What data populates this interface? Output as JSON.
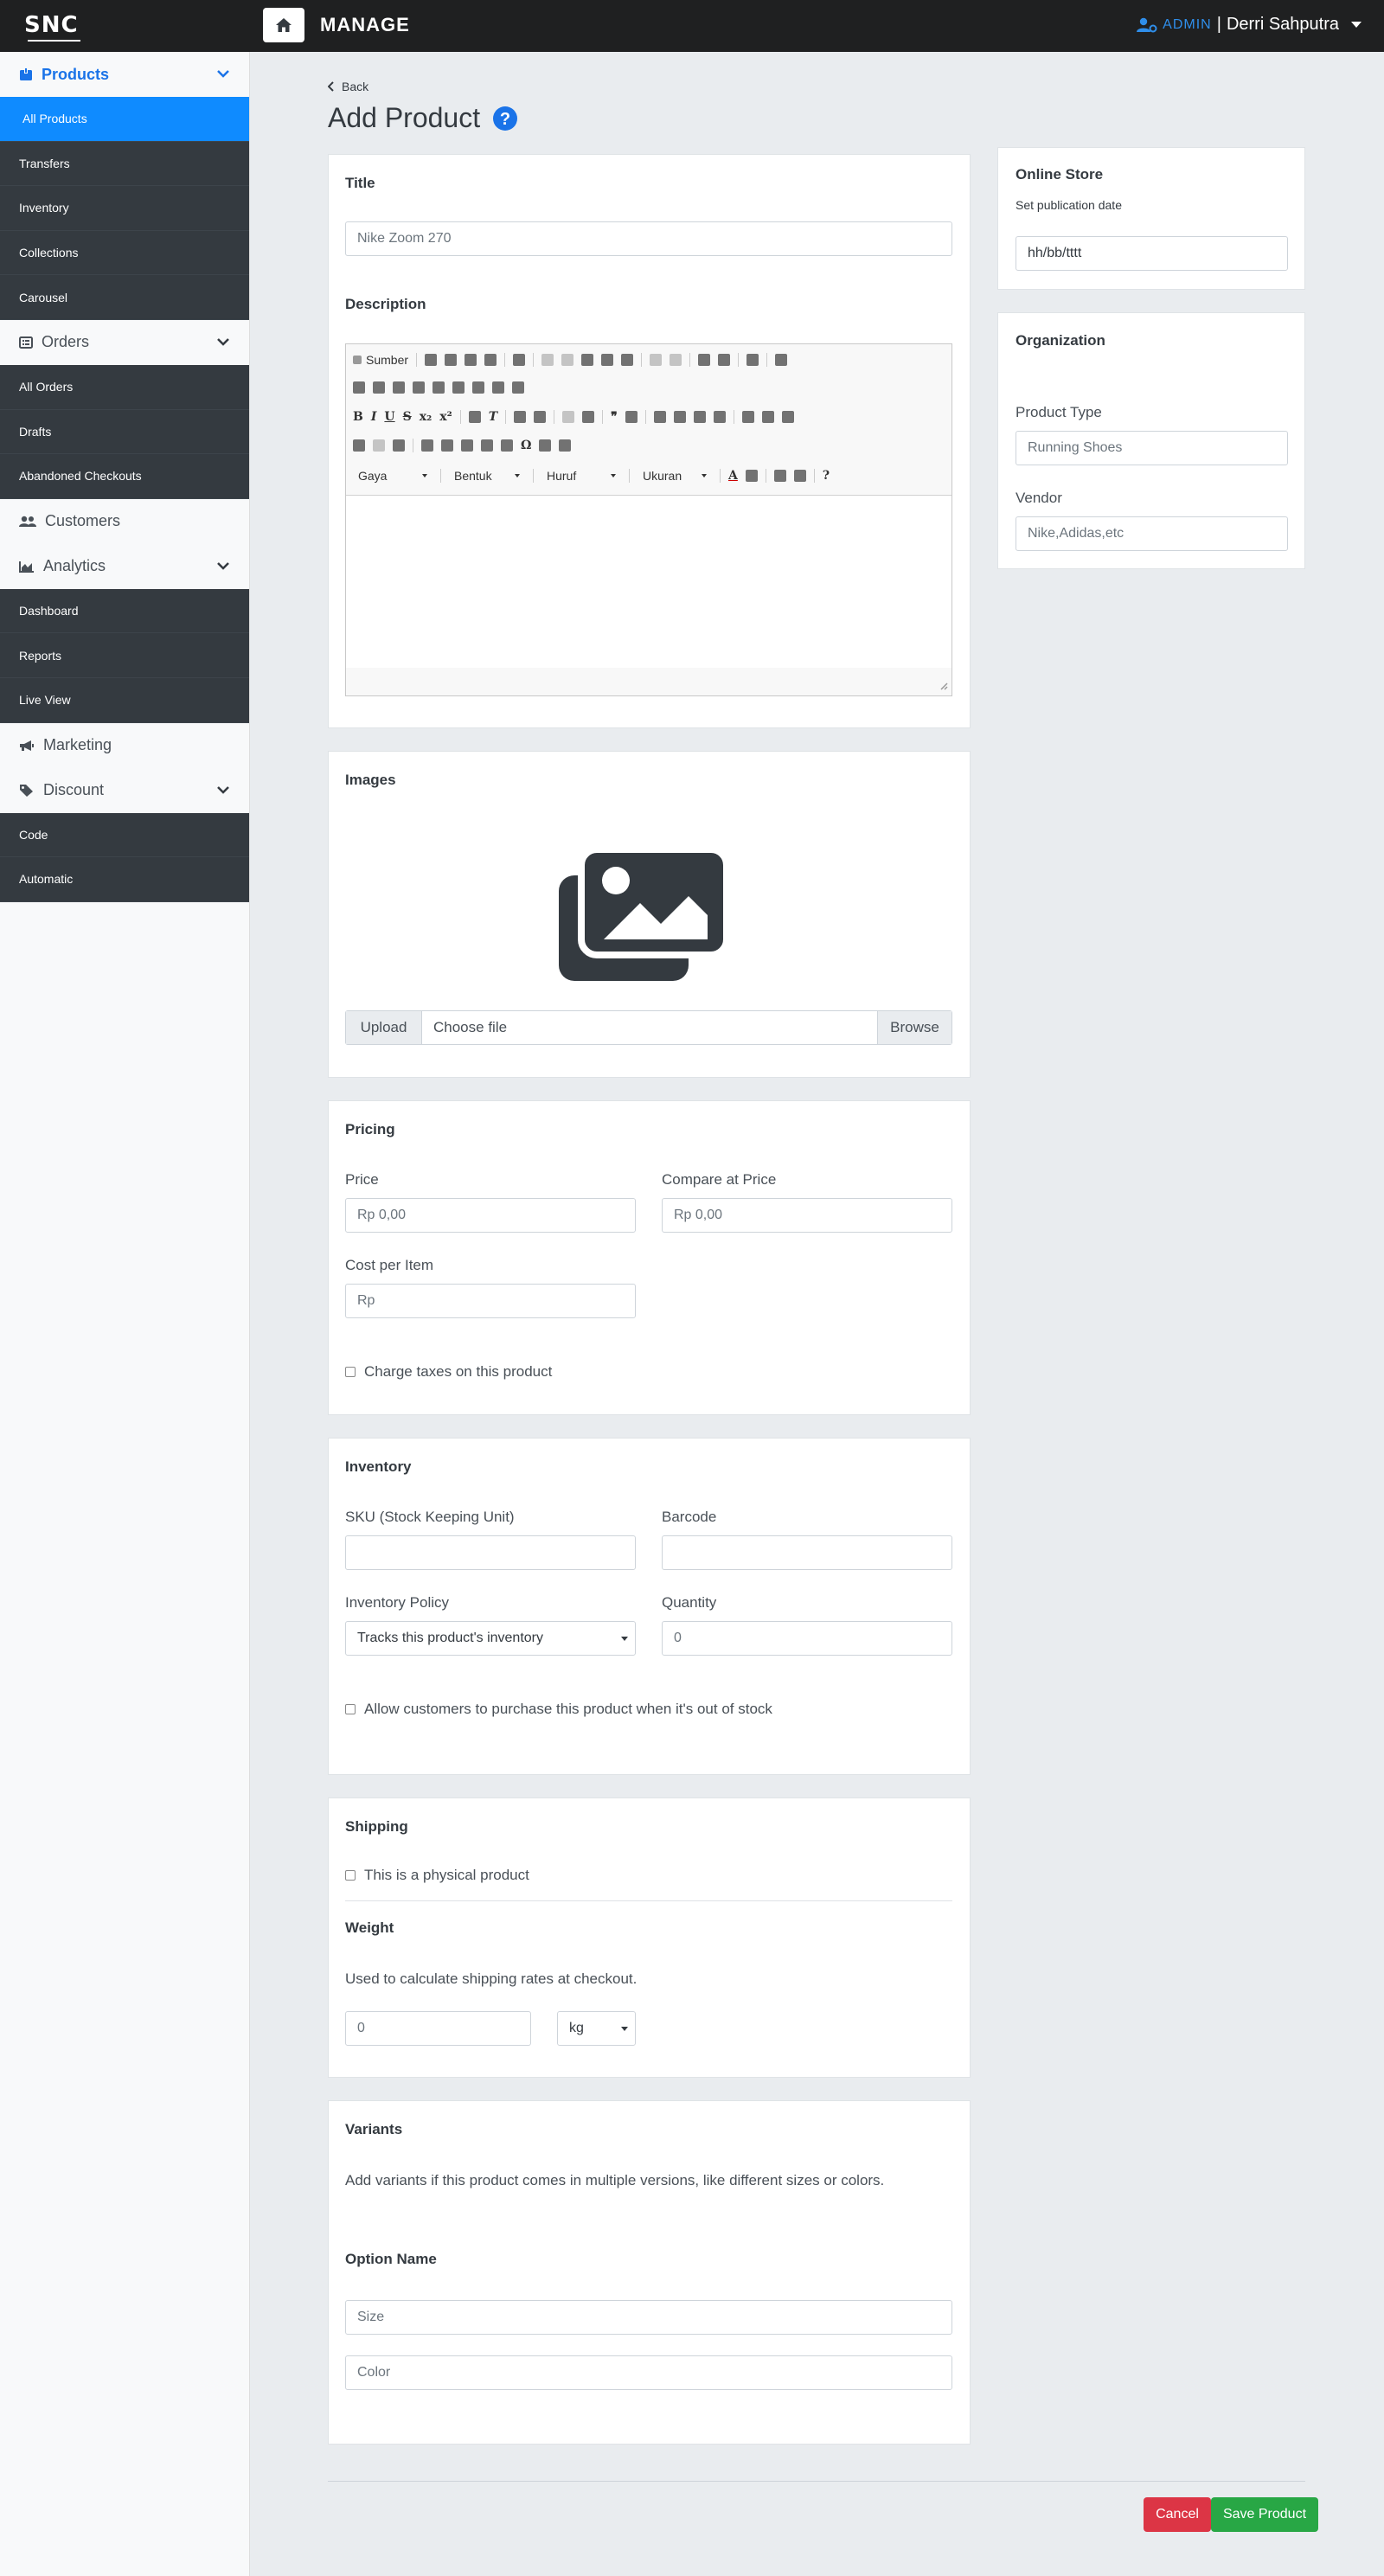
{
  "topbar": {
    "logo": "SNC",
    "title": "MANAGE",
    "role": "ADMIN",
    "divider": "|",
    "user": "Derri Sahputra"
  },
  "sidebar": {
    "products": {
      "label": "Products",
      "items": [
        "All Products",
        "Transfers",
        "Inventory",
        "Collections",
        "Carousel"
      ]
    },
    "orders": {
      "label": "Orders",
      "items": [
        "All Orders",
        "Drafts",
        "Abandoned Checkouts"
      ]
    },
    "customers": {
      "label": "Customers"
    },
    "analytics": {
      "label": "Analytics",
      "items": [
        "Dashboard",
        "Reports",
        "Live View"
      ]
    },
    "marketing": {
      "label": "Marketing"
    },
    "discount": {
      "label": "Discount",
      "items": [
        "Code",
        "Automatic"
      ]
    }
  },
  "page": {
    "back": "Back",
    "title": "Add Product"
  },
  "title_card": {
    "title_label": "Title",
    "title_placeholder": "Nike Zoom 270",
    "description_label": "Description",
    "toolbar": {
      "source": "Sumber",
      "style": "Gaya",
      "format": "Bentuk",
      "font": "Huruf",
      "size": "Ukuran"
    }
  },
  "images": {
    "heading": "Images",
    "upload": "Upload",
    "choose": "Choose file",
    "browse": "Browse"
  },
  "pricing": {
    "heading": "Pricing",
    "price_label": "Price",
    "price_placeholder": "Rp 0,00",
    "compare_label": "Compare at Price",
    "compare_placeholder": "Rp 0,00",
    "cost_label": "Cost per Item",
    "cost_placeholder": "Rp",
    "tax_label": "Charge taxes on this product"
  },
  "inventory": {
    "heading": "Inventory",
    "sku_label": "SKU (Stock Keeping Unit)",
    "barcode_label": "Barcode",
    "policy_label": "Inventory Policy",
    "policy_value": "Tracks this product's inventory",
    "quantity_label": "Quantity",
    "quantity_placeholder": "0",
    "oos_label": "Allow customers to purchase this product when it's out of stock"
  },
  "shipping": {
    "heading": "Shipping",
    "physical_label": "This is a physical product",
    "weight_heading": "Weight",
    "weight_help": "Used to calculate shipping rates at checkout.",
    "weight_placeholder": "0",
    "unit": "kg"
  },
  "variants": {
    "heading": "Variants",
    "help": "Add variants if this product comes in multiple versions, like different sizes or colors.",
    "option_heading": "Option Name",
    "option1_placeholder": "Size",
    "option2_placeholder": "Color"
  },
  "online_store": {
    "heading": "Online Store",
    "sub": "Set publication date",
    "date_placeholder": "hh/bb/tttt"
  },
  "organization": {
    "heading": "Organization",
    "type_label": "Product Type",
    "type_placeholder": "Running Shoes",
    "vendor_label": "Vendor",
    "vendor_placeholder": "Nike,Adidas,etc"
  },
  "actions": {
    "cancel": "Cancel",
    "save": "Save Product"
  },
  "colors": {
    "topbar": "#1f2021",
    "accent": "#0f8bff",
    "cancel": "#dc3545",
    "save": "#28a745"
  }
}
